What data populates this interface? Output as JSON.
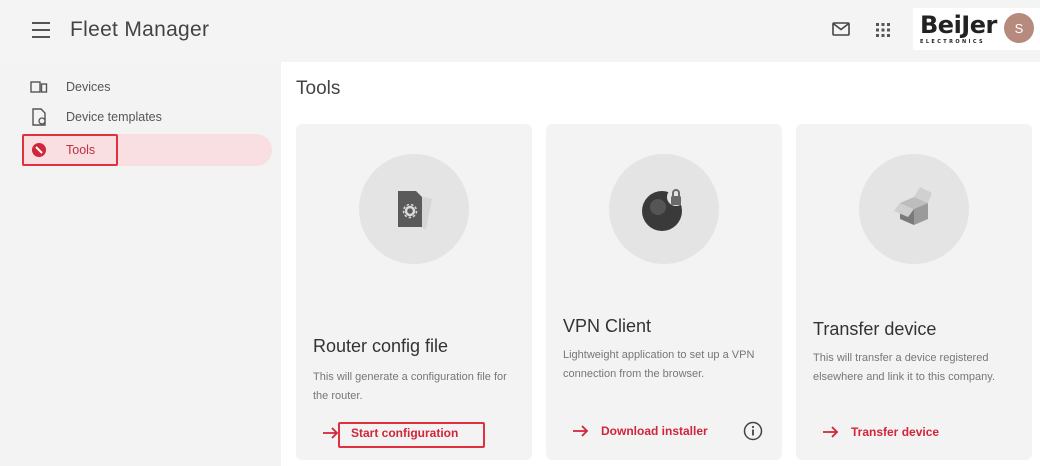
{
  "header": {
    "app_title": "Fleet Manager",
    "brand_name": "BeiJer",
    "brand_sub": "ELECTRONICS",
    "avatar_initial": "S"
  },
  "sidebar": {
    "items": [
      {
        "label": "Devices",
        "icon": "devices-icon",
        "active": false
      },
      {
        "label": "Device templates",
        "icon": "template-file-icon",
        "active": false
      },
      {
        "label": "Tools",
        "icon": "tools-icon",
        "active": true
      }
    ]
  },
  "main": {
    "page_title": "Tools",
    "cards": [
      {
        "title": "Router config file",
        "description": "This will generate a configuration file for the router.",
        "action_label": "Start configuration",
        "illustration": "router-config-file-icon"
      },
      {
        "title": "VPN Client",
        "description": "Lightweight application to set up a VPN connection from the browser.",
        "action_label": "Download installer",
        "illustration": "vpn-globe-lock-icon"
      },
      {
        "title": "Transfer device",
        "description": "This will transfer a device registered elsewhere and link it to this company.",
        "action_label": "Transfer device",
        "illustration": "open-box-icon"
      }
    ]
  },
  "colors": {
    "accent": "#d0253a",
    "highlight_box": "#e0313f",
    "active_nav_bg": "#f9dfe2",
    "card_bg": "#f3f3f3"
  }
}
